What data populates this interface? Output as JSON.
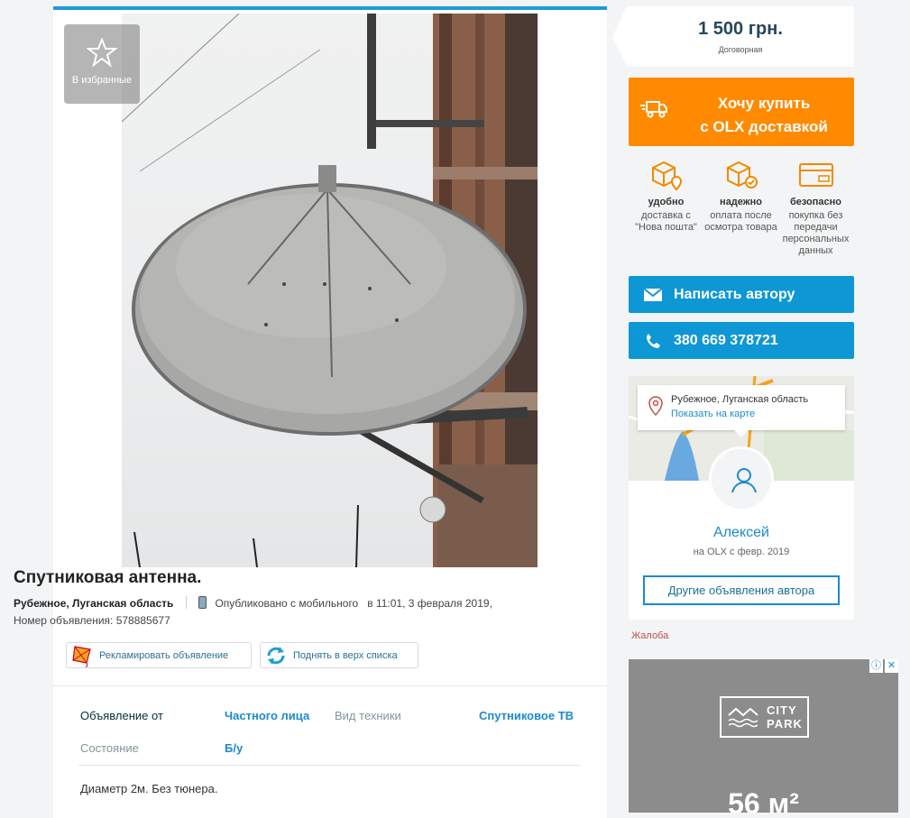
{
  "listing": {
    "favorites_label": "В избранные",
    "title": "Спутниковая антенна.",
    "location": "Рубежное, Луганская область",
    "published": "Опубликовано с мобильного",
    "published_time": "в 11:01, 3 февраля 2019,",
    "ad_number": "Номер объявления: 578885677",
    "promote_label": "Рекламировать объявление",
    "bump_label": "Поднять в верх списка",
    "params": [
      {
        "label": "Объявление от",
        "value": "Частного лица"
      },
      {
        "label": "Вид техники",
        "value": "Спутниковое ТВ"
      },
      {
        "label": "Состояние",
        "value": "Б/у"
      }
    ],
    "description": "Диаметр 2м. Без тюнера."
  },
  "sidebar": {
    "price": "1 500 грн.",
    "price_note": "Договорная",
    "buy_line1": "Хочу купить",
    "buy_line2": "с OLX доставкой",
    "features": [
      {
        "icon": "box-location-icon",
        "title": "удобно",
        "text": "доставка с \"Нова пошта\""
      },
      {
        "icon": "box-check-icon",
        "title": "надежно",
        "text": "оплата после осмотра товара"
      },
      {
        "icon": "card-icon",
        "title": "безопасно",
        "text": "покупка без передачи персональных данных"
      }
    ],
    "message_label": "Написать автору",
    "phone": "380 669 378721",
    "map_location": "Рубежное, Луганская область",
    "show_on_map": "Показать на карте",
    "seller_name": "Алексей",
    "seller_since": "на OLX с февр. 2019",
    "other_ads": "Другие объявления автора",
    "complaint": "Жалоба"
  },
  "ad": {
    "brand": "CITY",
    "brand2": "PARK",
    "headline": "56 м²",
    "info_icon": "ⓘ",
    "close_icon": "✕"
  },
  "colors": {
    "accent_blue": "#0e97d5",
    "buy_orange": "#ff8a00",
    "link_blue": "#1c8acb"
  }
}
